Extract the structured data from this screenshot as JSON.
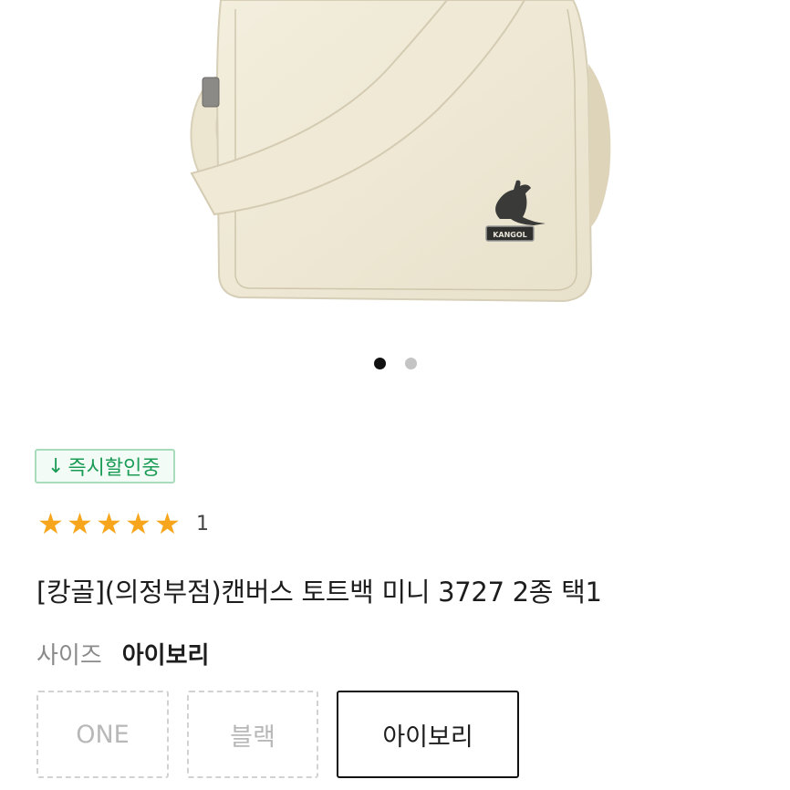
{
  "product_image": {
    "brand_tag": "KANGOL",
    "carousel": {
      "total": 2,
      "active_index": 0
    }
  },
  "badge": {
    "arrow_icon": "down-arrow-icon",
    "arrow": "↓",
    "label": "즉시할인중",
    "color": "#1a9b56"
  },
  "rating": {
    "stars": 5,
    "star_glyph": "★",
    "star_color": "#f7a51c",
    "count": "1"
  },
  "product": {
    "title": "[캉골](의정부점)캔버스 토트백 미니 3727 2종 택1"
  },
  "option": {
    "label": "사이즈",
    "selected_value": "아이보리",
    "choices": [
      {
        "label": "ONE",
        "state": "disabled"
      },
      {
        "label": "블랙",
        "state": "disabled"
      },
      {
        "label": "아이보리",
        "state": "selected"
      }
    ]
  }
}
